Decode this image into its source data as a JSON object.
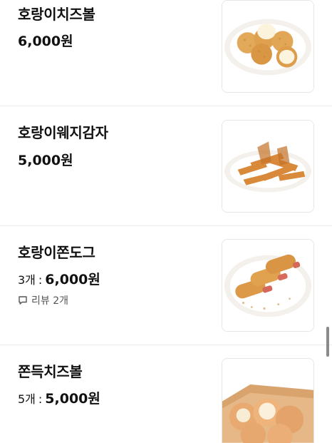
{
  "menu": {
    "items": [
      {
        "name": "호랑이치즈볼",
        "price": "6,000원",
        "image_icon": "cheese-ball-photo"
      },
      {
        "name": "호랑이웨지감자",
        "price": "5,000원",
        "image_icon": "wedge-potato-photo"
      },
      {
        "name": "호랑이쫀도그",
        "quantity": "3개",
        "separator": ":",
        "price": "6,000원",
        "review": "리뷰 2개",
        "review_icon": "speech-bubble-icon",
        "image_icon": "corndog-photo"
      },
      {
        "name": "쫀득치즈볼",
        "quantity": "5개",
        "separator": ":",
        "price": "5,000원",
        "image_icon": "chewy-cheese-ball-photo"
      }
    ]
  },
  "colors": {
    "text": "#111111",
    "muted": "#555555",
    "divider": "#ececec",
    "thumb_border": "#e6e6e6"
  }
}
